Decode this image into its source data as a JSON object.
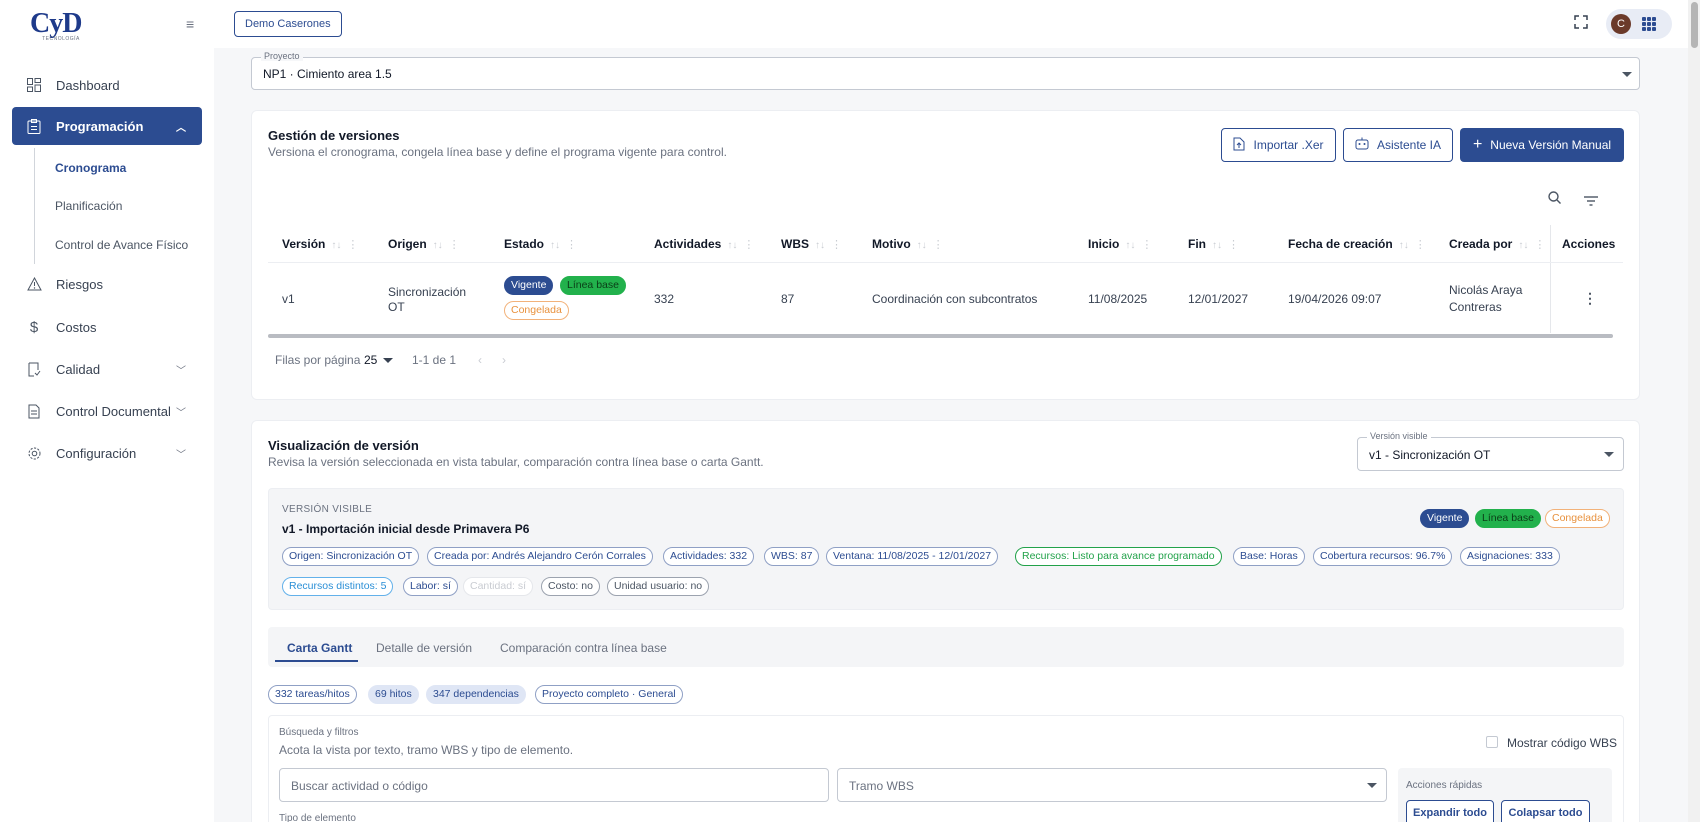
{
  "brand": {
    "logo_text": "CyD",
    "logo_sub": "TECNOLOGÍA"
  },
  "topbar": {
    "context_button": "Demo Caserones",
    "avatar_initial": "C"
  },
  "sidebar": {
    "items": [
      {
        "label": "Dashboard",
        "icon": "dashboard-icon"
      },
      {
        "label": "Programación",
        "icon": "clipboard-icon"
      },
      {
        "label": "Riesgos",
        "icon": "warning-icon"
      },
      {
        "label": "Costos",
        "icon": "dollar-icon"
      },
      {
        "label": "Calidad",
        "icon": "quality-icon"
      },
      {
        "label": "Control Documental",
        "icon": "document-icon"
      },
      {
        "label": "Configuración",
        "icon": "gear-icon"
      }
    ],
    "sub_items": [
      "Cronograma",
      "Planificación",
      "Control de Avance Físico"
    ]
  },
  "project_select": {
    "label": "Proyecto",
    "value": "NP1 · Cimiento area 1.5"
  },
  "versions": {
    "title": "Gestión de versiones",
    "subtitle": "Versiona el cronograma, congela línea base y define el programa vigente para control.",
    "btn_import": "Importar .Xer",
    "btn_ai": "Asistente IA",
    "btn_new": "Nueva Versión Manual",
    "columns": [
      "Versión",
      "Origen",
      "Estado",
      "Actividades",
      "WBS",
      "Motivo",
      "Inicio",
      "Fin",
      "Fecha de creación",
      "Creada por",
      "Acciones"
    ],
    "row": {
      "version": "v1",
      "origen_1": "Sincronización",
      "origen_2": "OT",
      "estado": [
        "Vigente",
        "Línea base",
        "Congelada"
      ],
      "actividades": "332",
      "wbs": "87",
      "motivo": "Coordinación con subcontratos",
      "inicio": "11/08/2025",
      "fin": "12/01/2027",
      "fecha_creacion": "19/04/2026 09:07",
      "creada_por_1": "Nicolás Araya",
      "creada_por_2": "Contreras"
    },
    "pager": {
      "rows_label": "Filas por página",
      "rows_value": "25",
      "range": "1-1 de 1"
    }
  },
  "visual": {
    "title": "Visualización de versión",
    "subtitle": "Revisa la versión seleccionada en vista tabular, comparación contra línea base o carta Gantt.",
    "select_label": "Versión visible",
    "select_value": "v1 - Sincronización OT",
    "info_label": "VERSIÓN VISIBLE",
    "info_title": "v1 - Importación inicial desde Primavera P6",
    "status_chips": [
      "Vigente",
      "Línea base",
      "Congelada"
    ],
    "chips_row1": [
      "Origen: Sincronización OT",
      "Creada por: Andrés Alejandro Cerón Corrales",
      "Actividades: 332",
      "WBS: 87",
      "Ventana: 11/08/2025 - 12/01/2027",
      "Recursos: Listo para avance programado",
      "Base: Horas",
      "Cobertura recursos: 96.7%",
      "Asignaciones: 333"
    ],
    "chips_row2": [
      "Recursos distintos: 5",
      "Labor: sí",
      "Cantidad: sí",
      "Costo: no",
      "Unidad usuario: no"
    ],
    "tabs": [
      "Carta Gantt",
      "Detalle de versión",
      "Comparación contra línea base"
    ],
    "summary_chips": [
      "332 tareas/hitos",
      "69 hitos",
      "347 dependencias",
      "Proyecto completo · General"
    ],
    "filters": {
      "title": "Búsqueda y filtros",
      "desc": "Acota la vista por texto, tramo WBS y tipo de elemento.",
      "show_wbs": "Mostrar código WBS",
      "search_placeholder": "Buscar actividad o código",
      "wbs_placeholder": "Tramo WBS",
      "quick_label": "Acciones rápidas",
      "btn_expand": "Expandir todo",
      "btn_collapse": "Colapsar todo",
      "type_label": "Tipo de elemento"
    }
  },
  "colors": {
    "primary": "#2c4c91",
    "success": "#22b14c",
    "warning": "#e8913d"
  }
}
